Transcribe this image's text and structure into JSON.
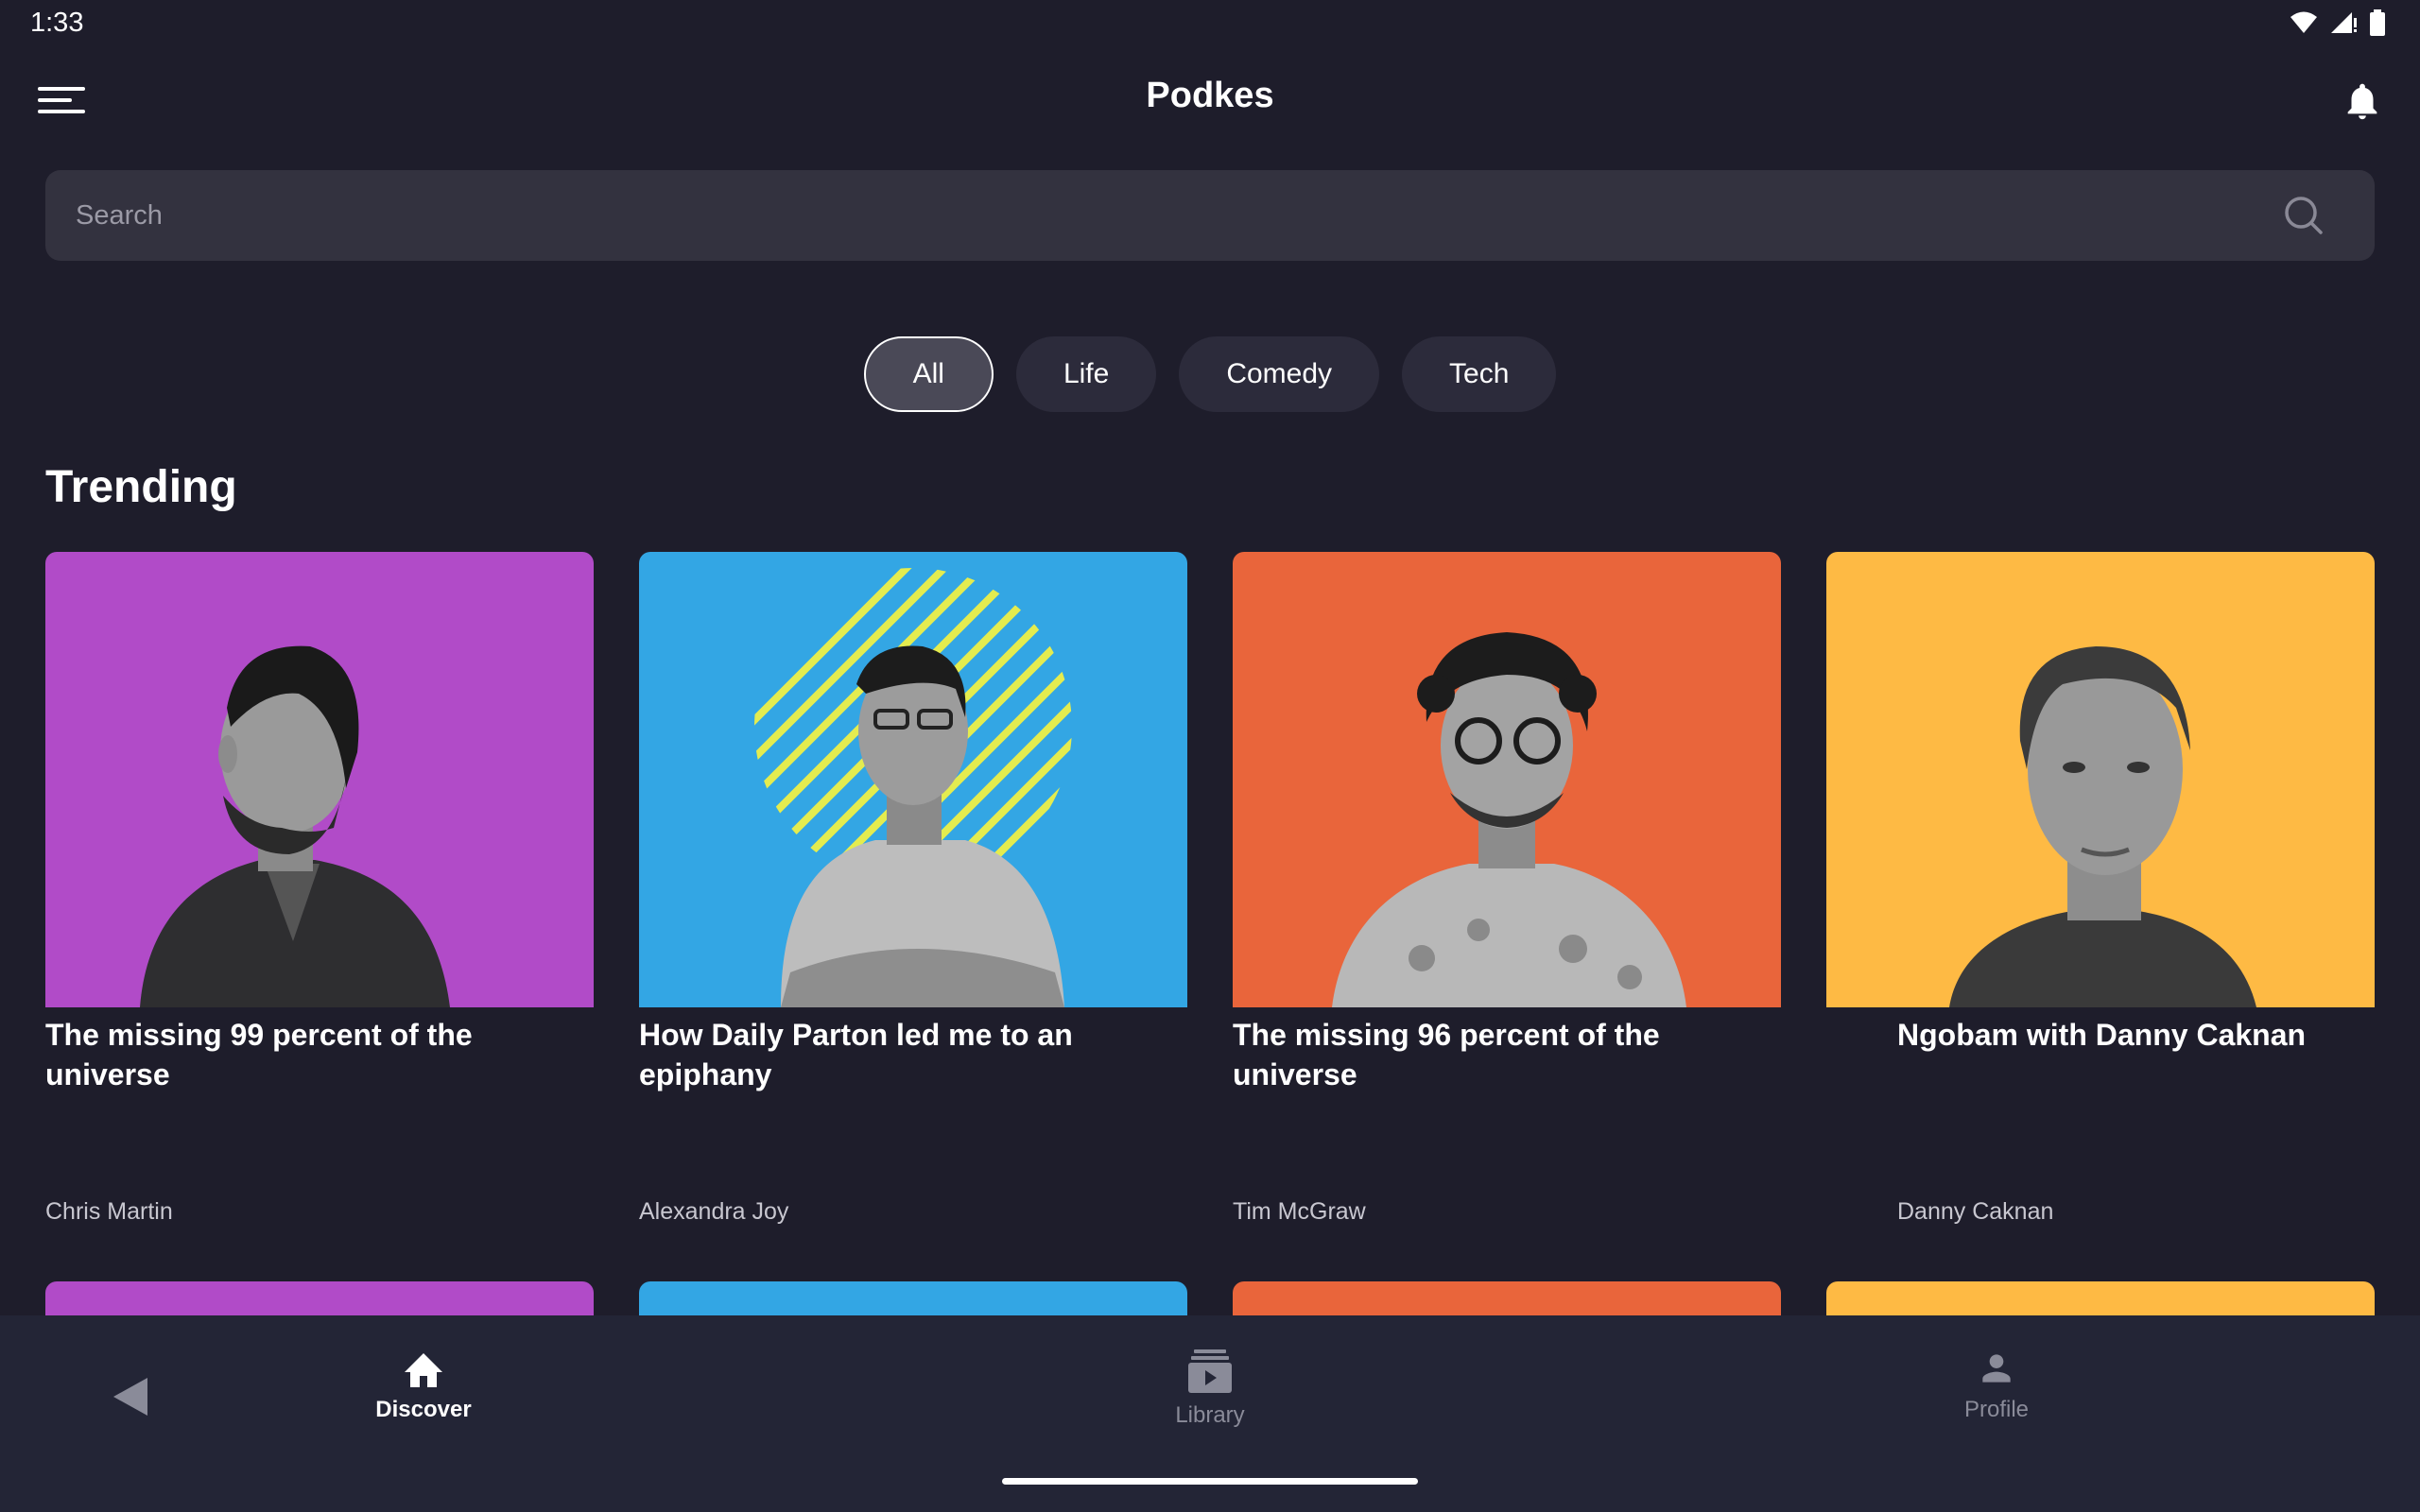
{
  "status_bar": {
    "time": "1:33"
  },
  "app_bar": {
    "title": "Podkes"
  },
  "search": {
    "placeholder": "Search",
    "value": ""
  },
  "filters": [
    {
      "label": "All",
      "selected": true
    },
    {
      "label": "Life",
      "selected": false
    },
    {
      "label": "Comedy",
      "selected": false
    },
    {
      "label": "Tech",
      "selected": false
    }
  ],
  "trending": {
    "heading": "Trending",
    "items": [
      {
        "title": "The missing 99 percent of the universe",
        "author": "Chris Martin",
        "color": "#b14bc8"
      },
      {
        "title": "How Daily Parton led me to an epiphany",
        "author": "Alexandra Joy",
        "color": "#33a6e4"
      },
      {
        "title": "The missing 96 percent of the universe",
        "author": "Tim McGraw",
        "color": "#e9653b"
      },
      {
        "title": "Ngobam with Danny Caknan",
        "author": "Danny Caknan",
        "color": "#feba44"
      }
    ]
  },
  "bottom_nav": {
    "items": [
      {
        "label": "Discover",
        "icon": "home-icon",
        "active": true
      },
      {
        "label": "Library",
        "icon": "library-icon",
        "active": false
      },
      {
        "label": "Profile",
        "icon": "person-icon",
        "active": false
      }
    ]
  },
  "colors": {
    "background": "#1e1d2b",
    "surface": "#33323f",
    "chip": "#2c2b3b",
    "nav_bar": "#232536"
  }
}
